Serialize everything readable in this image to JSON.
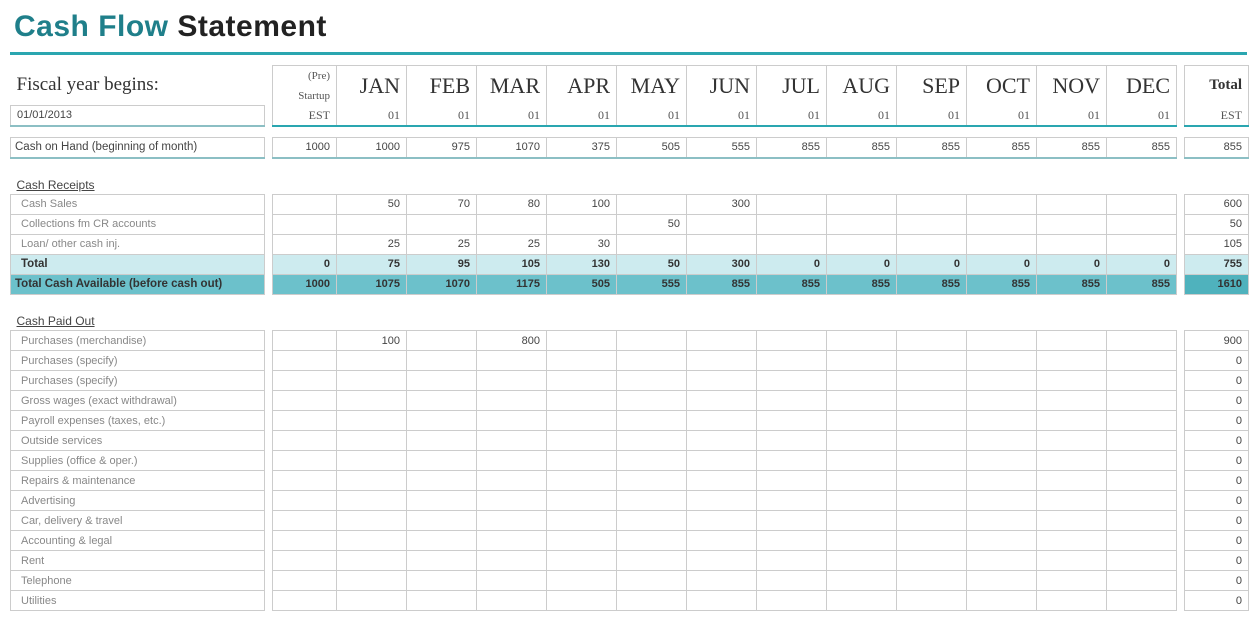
{
  "title": {
    "part1": "Cash Flow",
    "part2": "Statement"
  },
  "fiscal_year": {
    "label": "Fiscal year begins:",
    "date": "01/01/2013"
  },
  "header": {
    "pre_line1": "(Pre)",
    "pre_line2": "Startup",
    "pre_line3": "EST",
    "months": [
      "JAN",
      "FEB",
      "MAR",
      "APR",
      "MAY",
      "JUN",
      "JUL",
      "AUG",
      "SEP",
      "OCT",
      "NOV",
      "DEC"
    ],
    "month_sub": "01",
    "total_label": "Total",
    "total_sub": "EST"
  },
  "cash_on_hand": {
    "label": "Cash on Hand (beginning of month)",
    "values": [
      "1000",
      "1000",
      "975",
      "1070",
      "375",
      "505",
      "555",
      "855",
      "855",
      "855",
      "855",
      "855",
      "855"
    ],
    "total": "855"
  },
  "receipts": {
    "section_label": "Cash Receipts",
    "rows": [
      {
        "label": "Cash Sales",
        "values": [
          "",
          "50",
          "70",
          "80",
          "100",
          "",
          "300",
          "",
          "",
          "",
          "",
          "",
          ""
        ],
        "total": "600"
      },
      {
        "label": "Collections fm CR accounts",
        "values": [
          "",
          "",
          "",
          "",
          "",
          "50",
          "",
          "",
          "",
          "",
          "",
          "",
          ""
        ],
        "total": "50"
      },
      {
        "label": "Loan/ other cash inj.",
        "values": [
          "",
          "25",
          "25",
          "25",
          "30",
          "",
          "",
          "",
          "",
          "",
          "",
          "",
          ""
        ],
        "total": "105"
      }
    ],
    "subtotal": {
      "label": "Total",
      "values": [
        "0",
        "75",
        "95",
        "105",
        "130",
        "50",
        "300",
        "0",
        "0",
        "0",
        "0",
        "0",
        "0"
      ],
      "total": "755"
    },
    "grandtotal": {
      "label": "Total Cash Available (before cash out)",
      "values": [
        "1000",
        "1075",
        "1070",
        "1175",
        "505",
        "555",
        "855",
        "855",
        "855",
        "855",
        "855",
        "855",
        "855"
      ],
      "total": "1610"
    }
  },
  "paid_out": {
    "section_label": "Cash Paid Out",
    "rows": [
      {
        "label": "Purchases (merchandise)",
        "values": [
          "",
          "100",
          "",
          "800",
          "",
          "",
          "",
          "",
          "",
          "",
          "",
          "",
          ""
        ],
        "total": "900"
      },
      {
        "label": "Purchases (specify)",
        "values": [
          "",
          "",
          "",
          "",
          "",
          "",
          "",
          "",
          "",
          "",
          "",
          "",
          ""
        ],
        "total": "0"
      },
      {
        "label": "Purchases (specify)",
        "values": [
          "",
          "",
          "",
          "",
          "",
          "",
          "",
          "",
          "",
          "",
          "",
          "",
          ""
        ],
        "total": "0"
      },
      {
        "label": "Gross wages (exact withdrawal)",
        "values": [
          "",
          "",
          "",
          "",
          "",
          "",
          "",
          "",
          "",
          "",
          "",
          "",
          ""
        ],
        "total": "0"
      },
      {
        "label": "Payroll expenses (taxes, etc.)",
        "values": [
          "",
          "",
          "",
          "",
          "",
          "",
          "",
          "",
          "",
          "",
          "",
          "",
          ""
        ],
        "total": "0"
      },
      {
        "label": "Outside services",
        "values": [
          "",
          "",
          "",
          "",
          "",
          "",
          "",
          "",
          "",
          "",
          "",
          "",
          ""
        ],
        "total": "0"
      },
      {
        "label": "Supplies (office & oper.)",
        "values": [
          "",
          "",
          "",
          "",
          "",
          "",
          "",
          "",
          "",
          "",
          "",
          "",
          ""
        ],
        "total": "0"
      },
      {
        "label": "Repairs & maintenance",
        "values": [
          "",
          "",
          "",
          "",
          "",
          "",
          "",
          "",
          "",
          "",
          "",
          "",
          ""
        ],
        "total": "0"
      },
      {
        "label": "Advertising",
        "values": [
          "",
          "",
          "",
          "",
          "",
          "",
          "",
          "",
          "",
          "",
          "",
          "",
          ""
        ],
        "total": "0"
      },
      {
        "label": "Car, delivery & travel",
        "values": [
          "",
          "",
          "",
          "",
          "",
          "",
          "",
          "",
          "",
          "",
          "",
          "",
          ""
        ],
        "total": "0"
      },
      {
        "label": "Accounting & legal",
        "values": [
          "",
          "",
          "",
          "",
          "",
          "",
          "",
          "",
          "",
          "",
          "",
          "",
          ""
        ],
        "total": "0"
      },
      {
        "label": "Rent",
        "values": [
          "",
          "",
          "",
          "",
          "",
          "",
          "",
          "",
          "",
          "",
          "",
          "",
          ""
        ],
        "total": "0"
      },
      {
        "label": "Telephone",
        "values": [
          "",
          "",
          "",
          "",
          "",
          "",
          "",
          "",
          "",
          "",
          "",
          "",
          ""
        ],
        "total": "0"
      },
      {
        "label": "Utilities",
        "values": [
          "",
          "",
          "",
          "",
          "",
          "",
          "",
          "",
          "",
          "",
          "",
          "",
          ""
        ],
        "total": "0"
      }
    ]
  }
}
